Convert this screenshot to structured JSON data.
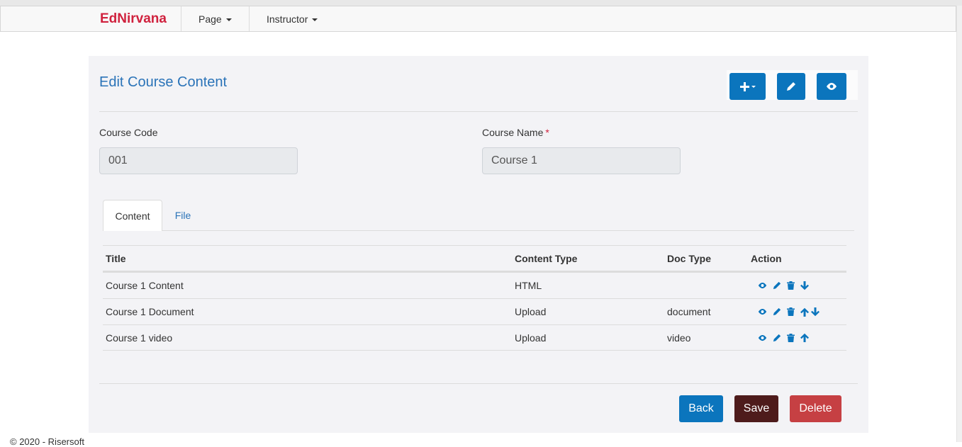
{
  "navbar": {
    "brand": "EdNirvana",
    "menu": [
      {
        "label": "Page"
      },
      {
        "label": "Instructor"
      }
    ]
  },
  "page": {
    "title": "Edit Course Content"
  },
  "form": {
    "course_code_label": "Course Code",
    "course_code_value": "001",
    "course_name_label": "Course Name",
    "course_name_required": "*",
    "course_name_value": "Course 1"
  },
  "tabs": [
    {
      "label": "Content",
      "active": true
    },
    {
      "label": "File",
      "active": false
    }
  ],
  "table": {
    "headers": [
      "Title",
      "Content Type",
      "Doc Type",
      "Action"
    ],
    "rows": [
      {
        "title": "Course 1 Content",
        "content_type": "HTML",
        "doc_type": "",
        "actions": [
          "eye-icon",
          "pencil-icon",
          "trash-icon",
          "arrow-down-icon"
        ]
      },
      {
        "title": "Course 1 Document",
        "content_type": "Upload",
        "doc_type": "document",
        "actions": [
          "eye-icon",
          "pencil-icon",
          "trash-icon",
          "arrow-up-icon",
          "arrow-down-icon"
        ]
      },
      {
        "title": "Course 1 video",
        "content_type": "Upload",
        "doc_type": "video",
        "actions": [
          "eye-icon",
          "pencil-icon",
          "trash-icon",
          "arrow-up-icon"
        ]
      }
    ]
  },
  "buttons": {
    "back": "Back",
    "save": "Save",
    "delete": "Delete"
  },
  "footer": {
    "text": "© 2020 - Risersoft"
  },
  "colors": {
    "brand": "#d0223e",
    "primary": "#0b75bd",
    "link": "#2a73b8",
    "save": "#4e1b1b",
    "danger": "#c64043"
  }
}
